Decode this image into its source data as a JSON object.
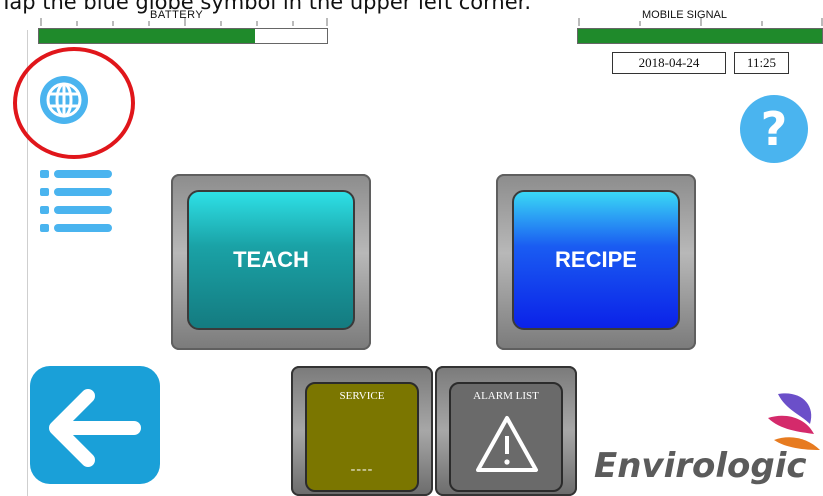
{
  "instruction": "Tap the blue globe symbol in the upper left corner.",
  "status": {
    "battery_label": "BATTERY",
    "battery_level": 0.75,
    "signal_label": "MOBILE SIGNAL",
    "signal_level": 1.0,
    "date": "2018-04-24",
    "time": "11:25"
  },
  "buttons": {
    "teach": "TEACH",
    "recipe": "RECIPE",
    "service_title": "SERVICE",
    "service_value": "----",
    "alarm_title": "ALARM LIST",
    "help": "?"
  },
  "icons": {
    "globe": "globe-icon",
    "menu": "list-menu-icon",
    "help": "question-icon",
    "back": "arrow-left-icon",
    "alarm": "warning-triangle-icon"
  },
  "brand": {
    "name": "Envirologic"
  },
  "colors": {
    "accent_blue": "#4ab4ef",
    "back_blue": "#1aa0d8",
    "bar_green": "#1f8a2b",
    "highlight_red": "#e0161b"
  }
}
